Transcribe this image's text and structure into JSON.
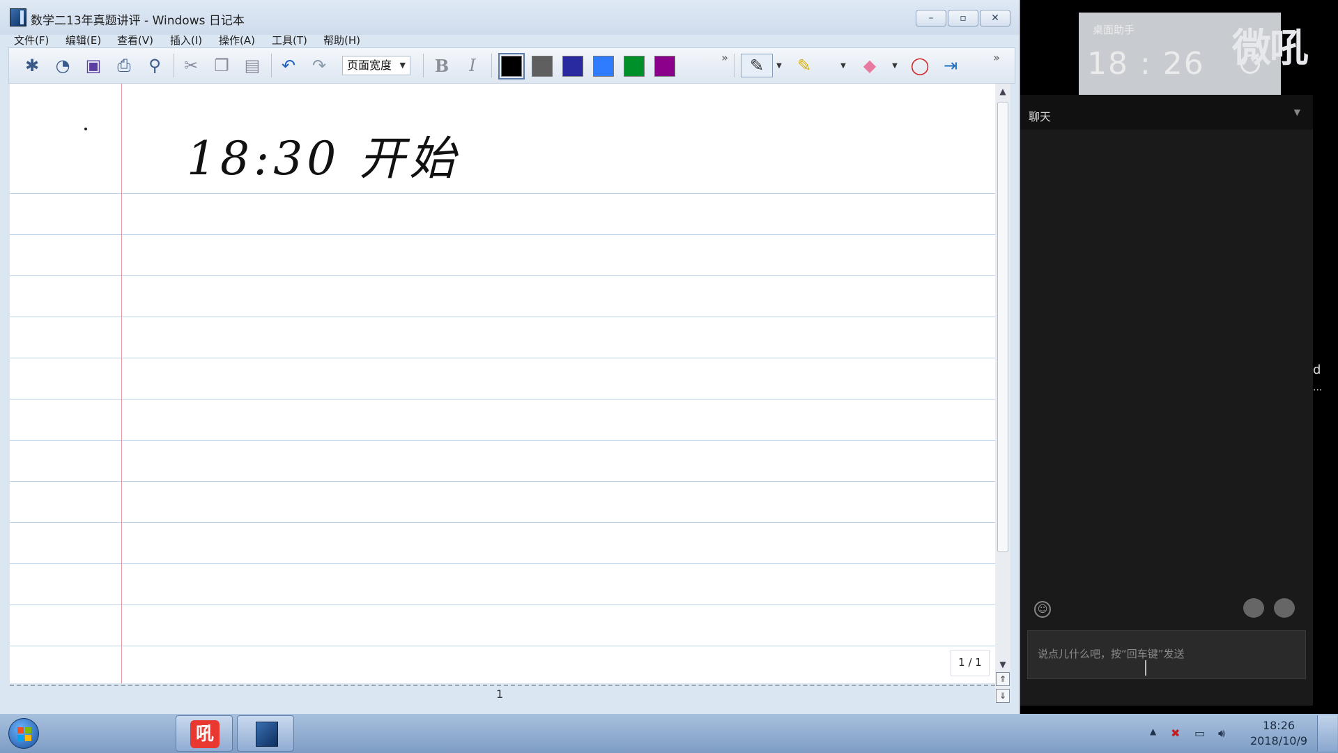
{
  "window": {
    "title": "数学二13年真题讲评 - Windows 日记本",
    "controls": {
      "minimize": "–",
      "maximize": "▫",
      "close": "✕"
    }
  },
  "menu": [
    "文件(F)",
    "编辑(E)",
    "查看(V)",
    "插入(I)",
    "操作(A)",
    "工具(T)",
    "帮助(H)"
  ],
  "toolbar": {
    "zoom_value": "页面宽度",
    "bold": "B",
    "italic": "I",
    "overflow": "»",
    "colors": [
      "#000000",
      "#5f5f5f",
      "#2a2aa0",
      "#2f7cff",
      "#00902a",
      "#8a008a"
    ],
    "icons": [
      "new-note-icon",
      "new-from-template-icon",
      "save-icon",
      "print-icon",
      "find-icon",
      "cut-icon",
      "copy-icon",
      "paste-icon",
      "undo-icon",
      "redo-icon",
      "pen-icon",
      "highlighter-icon",
      "eraser-icon",
      "lasso-icon",
      "insert-space-icon"
    ]
  },
  "page": {
    "handwriting": "18:30 开始",
    "page_indicator": "1 / 1",
    "page_number": "1"
  },
  "overlay": {
    "clock_label": "桌面助手",
    "clock_time": "18 : 26",
    "watermark": "微吼"
  },
  "chat": {
    "title": "聊天",
    "input_placeholder": "说点儿什么吧，按“回车键”发送"
  },
  "taskbar": {
    "app1_label": "吼",
    "time": "18:26",
    "date": "2018/10/9"
  },
  "edge": {
    "letter": "d",
    "dots": "..."
  }
}
